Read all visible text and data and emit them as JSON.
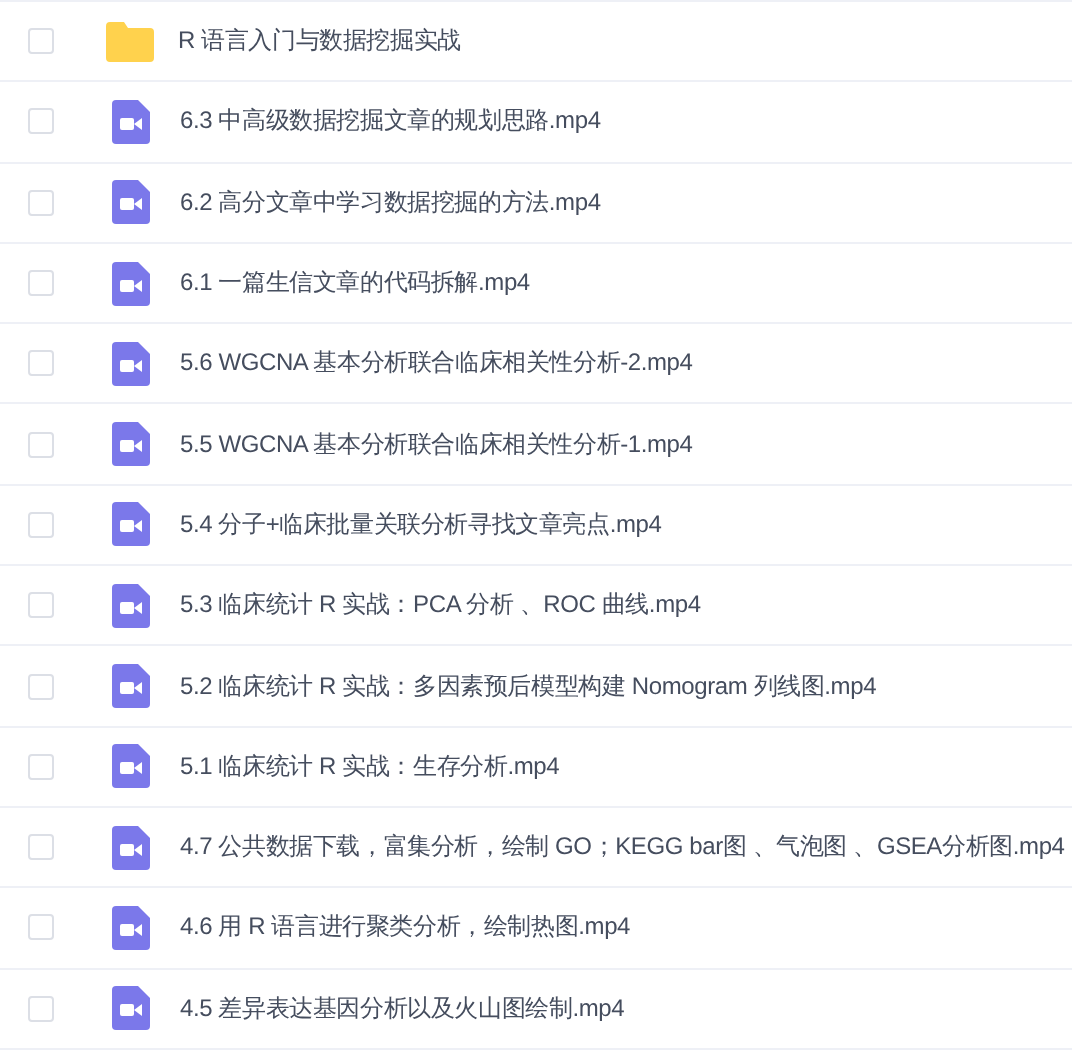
{
  "files": [
    {
      "kind": "folder",
      "name": "R 语言入门与数据挖掘实战",
      "checked": false
    },
    {
      "kind": "video",
      "name": "6.3 中高级数据挖掘文章的规划思路.mp4",
      "checked": false
    },
    {
      "kind": "video",
      "name": "6.2 高分文章中学习数据挖掘的方法.mp4",
      "checked": false
    },
    {
      "kind": "video",
      "name": "6.1 一篇生信文章的代码拆解.mp4",
      "checked": false
    },
    {
      "kind": "video",
      "name": "5.6 WGCNA 基本分析联合临床相关性分析-2.mp4",
      "checked": false
    },
    {
      "kind": "video",
      "name": "5.5 WGCNA 基本分析联合临床相关性分析-1.mp4",
      "checked": false
    },
    {
      "kind": "video",
      "name": "5.4 分子+临床批量关联分析寻找文章亮点.mp4",
      "checked": false
    },
    {
      "kind": "video",
      "name": "5.3 临床统计 R 实战：PCA 分析 、ROC 曲线.mp4",
      "checked": false
    },
    {
      "kind": "video",
      "name": "5.2 临床统计 R 实战：多因素预后模型构建 Nomogram 列线图.mp4",
      "checked": false
    },
    {
      "kind": "video",
      "name": "5.1 临床统计 R 实战：生存分析.mp4",
      "checked": false
    },
    {
      "kind": "video",
      "name": "4.7 公共数据下载，富集分析，绘制 GO；KEGG bar图 、气泡图 、GSEA分析图.mp4",
      "checked": false
    },
    {
      "kind": "video",
      "name": "4.6 用 R 语言进行聚类分析，绘制热图.mp4",
      "checked": false
    },
    {
      "kind": "video",
      "name": "4.5 差异表达基因分析以及火山图绘制.mp4",
      "checked": false
    }
  ]
}
